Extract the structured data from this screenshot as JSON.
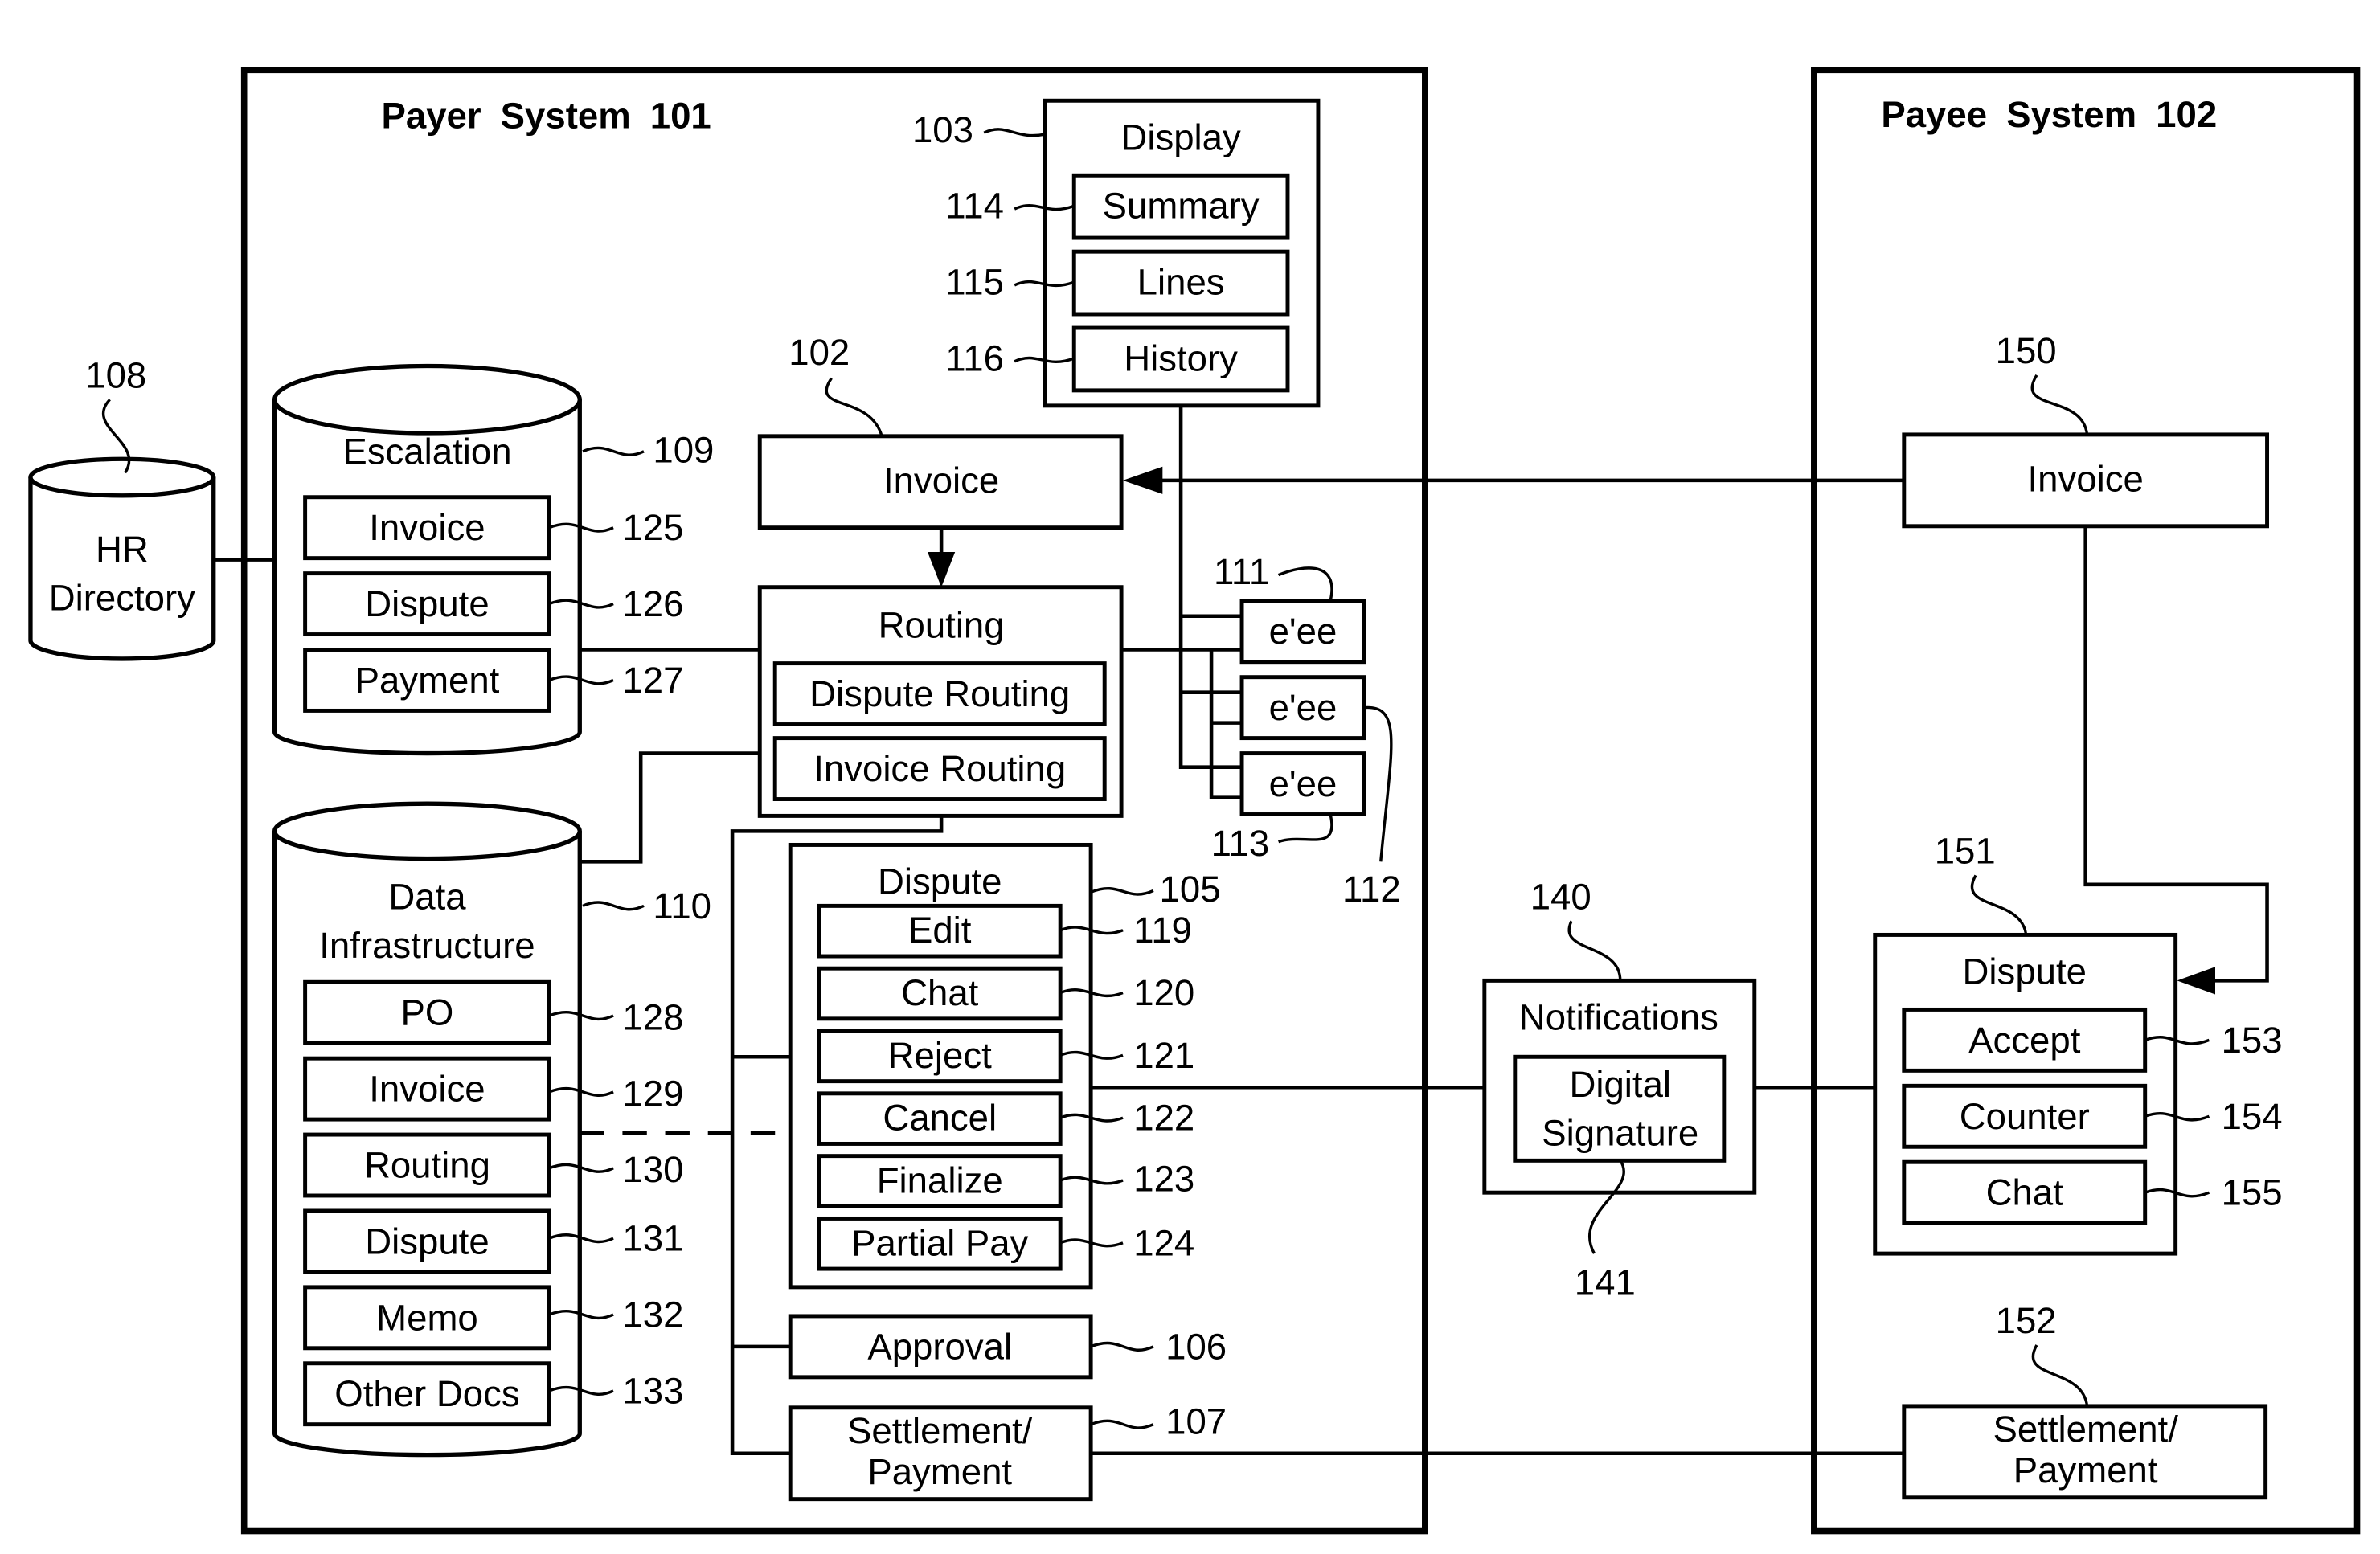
{
  "payer_system": {
    "title": "Payer System  101",
    "display": {
      "label": "Display",
      "ref": "103",
      "items": [
        {
          "label": "Summary",
          "ref": "114"
        },
        {
          "label": "Lines",
          "ref": "115"
        },
        {
          "label": "History",
          "ref": "116"
        }
      ]
    },
    "invoice": {
      "label": "Invoice",
      "ref": "102"
    },
    "routing": {
      "label": "Routing",
      "items": [
        {
          "label": "Dispute Routing"
        },
        {
          "label": "Invoice Routing"
        }
      ]
    },
    "employees": {
      "items": [
        {
          "label": "e'ee"
        },
        {
          "label": "e'ee"
        },
        {
          "label": "e'ee"
        }
      ],
      "refs": [
        "111",
        "112",
        "113"
      ]
    },
    "escalation": {
      "label": "Escalation",
      "ref": "109",
      "items": [
        {
          "label": "Invoice",
          "ref": "125"
        },
        {
          "label": "Dispute",
          "ref": "126"
        },
        {
          "label": "Payment",
          "ref": "127"
        }
      ]
    },
    "data_infrastructure": {
      "label_line1": "Data",
      "label_line2": "Infrastructure",
      "ref": "110",
      "items": [
        {
          "label": "PO",
          "ref": "128"
        },
        {
          "label": "Invoice",
          "ref": "129"
        },
        {
          "label": "Routing",
          "ref": "130"
        },
        {
          "label": "Dispute",
          "ref": "131"
        },
        {
          "label": "Memo",
          "ref": "132"
        },
        {
          "label": "Other Docs",
          "ref": "133"
        }
      ]
    },
    "dispute": {
      "label": "Dispute",
      "ref": "105",
      "items": [
        {
          "label": "Edit",
          "ref": "119"
        },
        {
          "label": "Chat",
          "ref": "120"
        },
        {
          "label": "Reject",
          "ref": "121"
        },
        {
          "label": "Cancel",
          "ref": "122"
        },
        {
          "label": "Finalize",
          "ref": "123"
        },
        {
          "label": "Partial Pay",
          "ref": "124"
        }
      ]
    },
    "approval": {
      "label": "Approval",
      "ref": "106"
    },
    "settlement": {
      "label_line1": "Settlement/",
      "label_line2": "Payment",
      "ref": "107"
    }
  },
  "hr_directory": {
    "label_line1": "HR",
    "label_line2": "Directory",
    "ref": "108"
  },
  "notifications": {
    "label": "Notifications",
    "ref": "140",
    "digital_signature": {
      "label_line1": "Digital",
      "label_line2": "Signature",
      "ref": "141"
    }
  },
  "payee_system": {
    "title": "Payee System   102",
    "invoice": {
      "label": "Invoice",
      "ref": "150"
    },
    "dispute": {
      "label": "Dispute",
      "ref": "151",
      "items": [
        {
          "label": "Accept",
          "ref": "153"
        },
        {
          "label": "Counter",
          "ref": "154"
        },
        {
          "label": "Chat",
          "ref": "155"
        }
      ]
    },
    "settlement": {
      "label_line1": "Settlement/",
      "label_line2": "Payment",
      "ref": "152"
    }
  }
}
